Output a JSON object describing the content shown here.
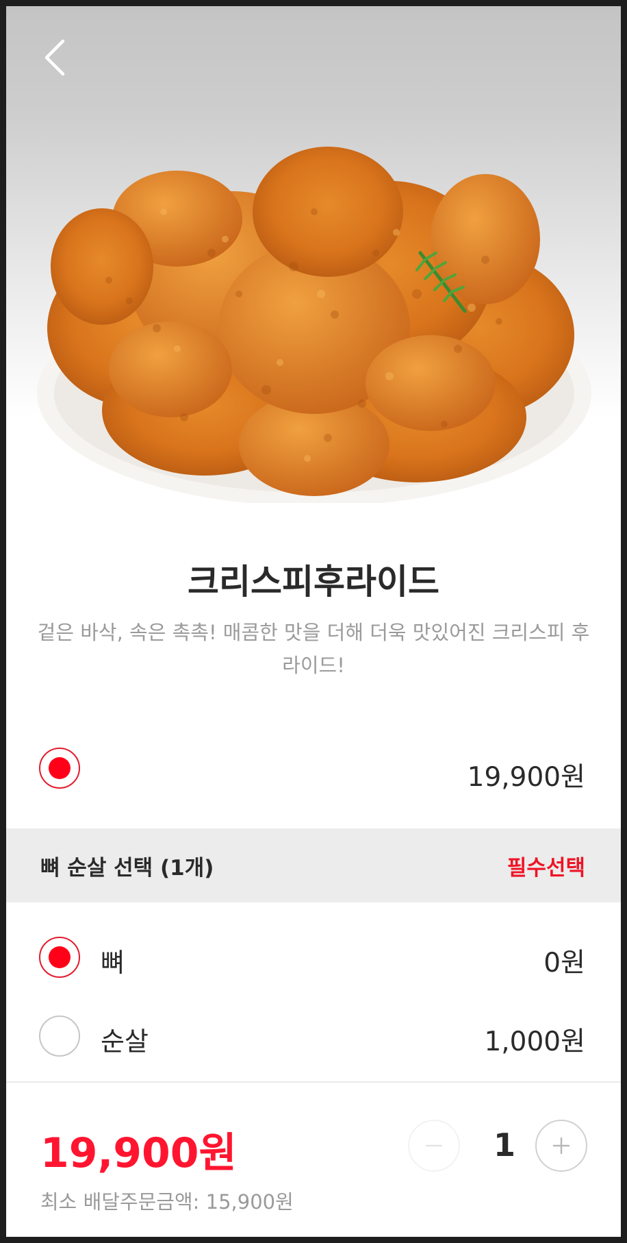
{
  "product": {
    "name": "크리스피후라이드",
    "description": "겉은 바삭, 속은 촉촉! 매콤한 맛을 더해 더욱 맛있어진 크리스피 후라이드!",
    "base_price": "19,900원"
  },
  "option_group": {
    "title": "뼈 순살 선택 (1개)",
    "badge": "필수선택",
    "options": [
      {
        "label": "뼈",
        "price": "0원",
        "selected": true
      },
      {
        "label": "순살",
        "price": "1,000원",
        "selected": false
      }
    ]
  },
  "footer": {
    "total": "19,900원",
    "min_order": "최소 배달주문금액: 15,900원",
    "quantity": "1"
  },
  "icons": {
    "back": "chevron-left-icon",
    "minus": "minus-icon",
    "plus": "plus-icon"
  },
  "colors": {
    "accent": "#ff1530",
    "badge": "#ee1426",
    "muted_text": "#9a9a9a"
  }
}
